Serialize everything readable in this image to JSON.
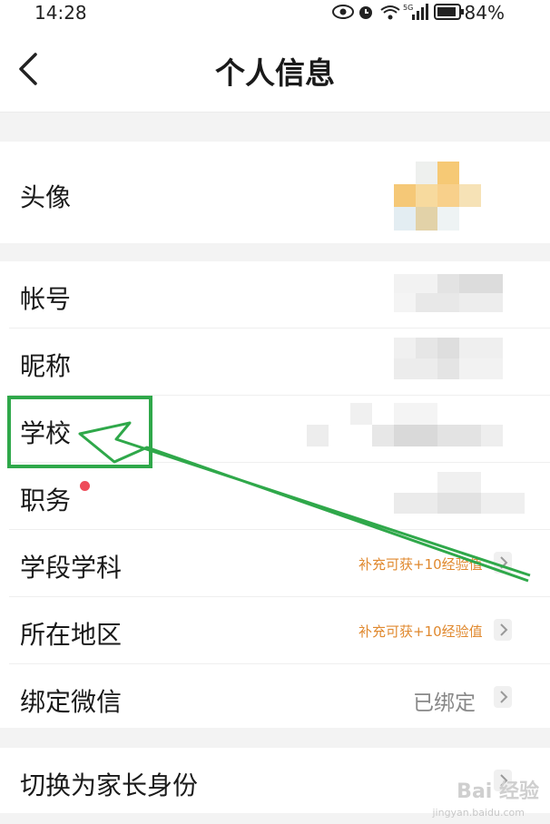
{
  "status_bar": {
    "time": "14:28",
    "battery": "84%"
  },
  "header": {
    "title": "个人信息"
  },
  "rows": {
    "avatar": "头像",
    "account": "帐号",
    "nickname": "昵称",
    "school": "学校",
    "position": "职务",
    "stage_subject": "学段学科",
    "region": "所在地区",
    "wechat": "绑定微信",
    "switch_parent": "切换为家长身份"
  },
  "values": {
    "stage_subject_hint": "补充可获+10经验值",
    "region_hint": "补充可获+10经验值",
    "wechat_status": "已绑定"
  },
  "colors": {
    "highlight": "#2fa84a",
    "hint": "#e0892f",
    "badge": "#ee4c5a"
  },
  "watermark": {
    "brand": "Bai 经验",
    "url": "jingyan.baidu.com"
  }
}
